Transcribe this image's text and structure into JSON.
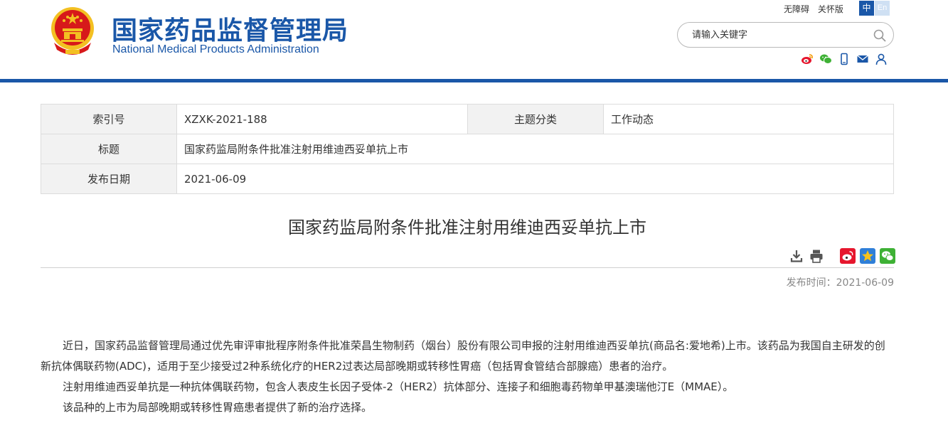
{
  "header": {
    "title_cn": "国家药品监督管理局",
    "title_en": "National Medical Products Administration",
    "accessibility_label": "无障碍",
    "care_label": "关怀版",
    "lang_zh": "中",
    "lang_en": "En",
    "search": {
      "placeholder": "请输入关键字"
    },
    "social_icons": [
      "weibo-icon",
      "wechat-icon",
      "mobile-icon",
      "mail-icon",
      "user-icon"
    ]
  },
  "colors": {
    "brand_blue": "#1a57a8",
    "emblem_red": "#d7191a",
    "emblem_gold": "#f3c022"
  },
  "meta": {
    "index_label": "索引号",
    "index_value": "XZXK-2021-188",
    "topic_label": "主题分类",
    "topic_value": "工作动态",
    "title_label": "标题",
    "title_value": "国家药监局附条件批准注射用维迪西妥单抗上市",
    "date_label": "发布日期",
    "date_value": "2021-06-09"
  },
  "article": {
    "title": "国家药监局附条件批准注射用维迪西妥单抗上市",
    "tools": [
      "download-icon",
      "print-icon",
      "share-weibo-icon",
      "favorite-icon",
      "share-wechat-icon"
    ],
    "pub_time": "发布时间：2021-06-09",
    "paragraphs": [
      "近日，国家药品监督管理局通过优先审评审批程序附条件批准荣昌生物制药（烟台）股份有限公司申报的注射用维迪西妥单抗(商品名:爱地希)上市。该药品为我国自主研发的创新抗体偶联药物(ADC)，适用于至少接受过2种系统化疗的HER2过表达局部晚期或转移性胃癌（包括胃食管结合部腺癌）患者的治疗。",
      "注射用维迪西妥单抗是一种抗体偶联药物，包含人表皮生长因子受体-2（HER2）抗体部分、连接子和细胞毒药物单甲基澳瑞他汀E（MMAE）。",
      "该品种的上市为局部晚期或转移性胃癌患者提供了新的治疗选择。"
    ]
  }
}
